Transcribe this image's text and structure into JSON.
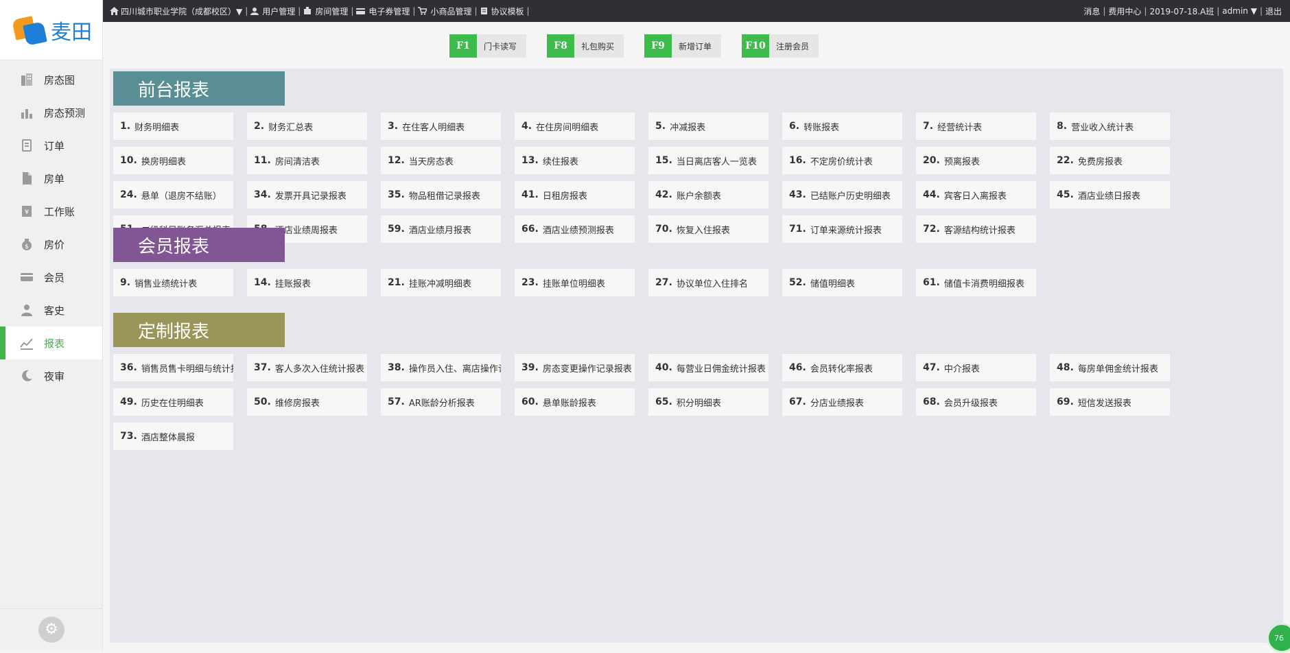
{
  "brand": {
    "name": "麦田"
  },
  "sidebar": {
    "items": [
      {
        "label": "房态图",
        "icon": "building-icon",
        "active": false
      },
      {
        "label": "房态预测",
        "icon": "bar-chart-icon",
        "active": false
      },
      {
        "label": "订单",
        "icon": "order-icon",
        "active": false
      },
      {
        "label": "房单",
        "icon": "document-icon",
        "active": false
      },
      {
        "label": "工作账",
        "icon": "ledger-icon",
        "active": false
      },
      {
        "label": "房价",
        "icon": "money-bag-icon",
        "active": false
      },
      {
        "label": "会员",
        "icon": "card-icon",
        "active": false
      },
      {
        "label": "客史",
        "icon": "person-icon",
        "active": false
      },
      {
        "label": "报表",
        "icon": "trend-chart-icon",
        "active": true
      },
      {
        "label": "夜审",
        "icon": "moon-icon",
        "active": false
      }
    ]
  },
  "topbar": {
    "hotel": "四川城市职业学院（成都校区）▼",
    "links": [
      "用户管理",
      "房间管理",
      "电子券管理",
      "小商品管理",
      "协议模板"
    ],
    "right": {
      "messages": "消息",
      "fee_center": "费用中心",
      "shift": "2019-07-18.A班",
      "user": "admin ▼",
      "exit": "退出"
    }
  },
  "hotkeys": [
    {
      "key": "F1",
      "label": "门卡读写"
    },
    {
      "key": "F8",
      "label": "礼包购买"
    },
    {
      "key": "F9",
      "label": "新增订单"
    },
    {
      "key": "F10",
      "label": "注册会员"
    }
  ],
  "sections": [
    {
      "title": "前台报表",
      "color": "#5a8e95",
      "reports": [
        {
          "num": "1.",
          "name": "财务明细表"
        },
        {
          "num": "2.",
          "name": "财务汇总表"
        },
        {
          "num": "3.",
          "name": "在住客人明细表"
        },
        {
          "num": "4.",
          "name": "在住房间明细表"
        },
        {
          "num": "5.",
          "name": "冲减报表"
        },
        {
          "num": "6.",
          "name": "转账报表"
        },
        {
          "num": "7.",
          "name": "经营统计表"
        },
        {
          "num": "8.",
          "name": "营业收入统计表"
        },
        {
          "num": "10.",
          "name": "换房明细表"
        },
        {
          "num": "11.",
          "name": "房间清洁表"
        },
        {
          "num": "12.",
          "name": "当天房态表"
        },
        {
          "num": "13.",
          "name": "续住报表"
        },
        {
          "num": "15.",
          "name": "当日离店客人一览表"
        },
        {
          "num": "16.",
          "name": "不定房价统计表"
        },
        {
          "num": "20.",
          "name": "预离报表"
        },
        {
          "num": "22.",
          "name": "免费房报表"
        },
        {
          "num": "24.",
          "name": "悬单（退房不结账）"
        },
        {
          "num": "34.",
          "name": "发票开具记录报表"
        },
        {
          "num": "35.",
          "name": "物品租借记录报表"
        },
        {
          "num": "41.",
          "name": "日租房报表"
        },
        {
          "num": "42.",
          "name": "账户余额表"
        },
        {
          "num": "43.",
          "name": "已结账户历史明细表"
        },
        {
          "num": "44.",
          "name": "宾客日入离报表"
        },
        {
          "num": "45.",
          "name": "酒店业绩日报表"
        },
        {
          "num": "51.",
          "name": "二级科目账务汇总报表"
        },
        {
          "num": "58.",
          "name": "酒店业绩周报表"
        },
        {
          "num": "59.",
          "name": "酒店业绩月报表"
        },
        {
          "num": "66.",
          "name": "酒店业绩预测报表"
        },
        {
          "num": "70.",
          "name": "恢复入住报表"
        },
        {
          "num": "71.",
          "name": "订单来源统计报表"
        },
        {
          "num": "72.",
          "name": "客源结构统计报表"
        }
      ]
    },
    {
      "title": "会员报表",
      "color": "#825695",
      "reports": [
        {
          "num": "9.",
          "name": "销售业绩统计表"
        },
        {
          "num": "14.",
          "name": "挂账报表"
        },
        {
          "num": "21.",
          "name": "挂账冲减明细表"
        },
        {
          "num": "23.",
          "name": "挂账单位明细表"
        },
        {
          "num": "27.",
          "name": "协议单位入住排名"
        },
        {
          "num": "52.",
          "name": "储值明细表"
        },
        {
          "num": "61.",
          "name": "储值卡消费明细报表"
        }
      ]
    },
    {
      "title": "定制报表",
      "color": "#9a9559",
      "reports": [
        {
          "num": "36.",
          "name": "销售员售卡明细与统计报表"
        },
        {
          "num": "37.",
          "name": "客人多次入住统计报表"
        },
        {
          "num": "38.",
          "name": "操作员入住、离店操作记录"
        },
        {
          "num": "39.",
          "name": "房态变更操作记录报表"
        },
        {
          "num": "40.",
          "name": "每营业日佣金统计报表"
        },
        {
          "num": "46.",
          "name": "会员转化率报表"
        },
        {
          "num": "47.",
          "name": "中介报表"
        },
        {
          "num": "48.",
          "name": "每房单佣金统计报表"
        },
        {
          "num": "49.",
          "name": "历史在住明细表"
        },
        {
          "num": "50.",
          "name": "维修房报表"
        },
        {
          "num": "57.",
          "name": "AR账龄分析报表"
        },
        {
          "num": "60.",
          "name": "悬单账龄报表"
        },
        {
          "num": "65.",
          "name": "积分明细表"
        },
        {
          "num": "67.",
          "name": "分店业绩报表"
        },
        {
          "num": "68.",
          "name": "会员升级报表"
        },
        {
          "num": "69.",
          "name": "短信发送报表"
        },
        {
          "num": "73.",
          "name": "酒店整体晨报"
        }
      ]
    }
  ],
  "badge": {
    "text": "76"
  }
}
